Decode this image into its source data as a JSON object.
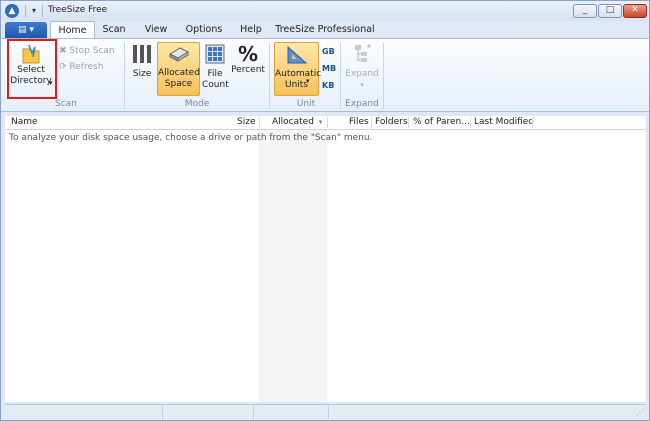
{
  "window": {
    "title": "TreeSize Free"
  },
  "tabs": [
    "Home",
    "Scan",
    "View",
    "Options",
    "Help",
    "TreeSize Professional"
  ],
  "ribbon": {
    "scan_group": {
      "select_directory": "Select\nDirectory",
      "stop_scan": "Stop Scan",
      "refresh": "Refresh",
      "label": "Scan"
    },
    "mode_group": {
      "size": "Size",
      "allocated_space": "Allocated\nSpace",
      "file_count": "File\nCount",
      "percent": "Percent",
      "label": "Mode"
    },
    "unit_group": {
      "automatic_units": "Automatic\nUnits",
      "gb": "GB",
      "mb": "MB",
      "kb": "KB",
      "label": "Unit"
    },
    "expand_group": {
      "expand": "Expand",
      "label": "Expand"
    }
  },
  "columns": [
    "Name",
    "Size",
    "Allocated",
    "Files",
    "Folders",
    "% of Paren...",
    "Last Modified"
  ],
  "content": {
    "hint": "To analyze your disk space usage, choose a drive or path from the \"Scan\" menu."
  },
  "colors": {
    "accent": "#1e58ad",
    "highlight": "#f6c15a",
    "selection_outline": "#e01b1b"
  }
}
